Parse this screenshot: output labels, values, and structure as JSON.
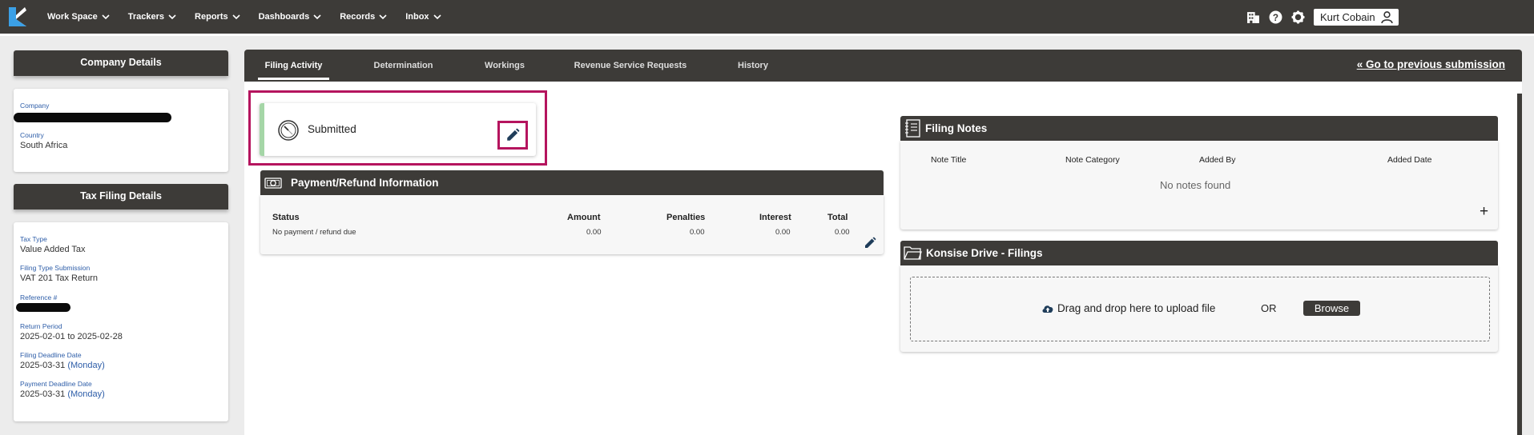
{
  "nav": {
    "items": [
      {
        "label": "Work Space"
      },
      {
        "label": "Trackers"
      },
      {
        "label": "Reports"
      },
      {
        "label": "Dashboards"
      },
      {
        "label": "Records"
      },
      {
        "label": "Inbox"
      }
    ],
    "right_icons": [
      "building-icon",
      "help-icon",
      "gear-icon"
    ],
    "user_name": "Kurt Cobain"
  },
  "sidebar": {
    "company_details": {
      "title": "Company Details",
      "company_label": "Company",
      "country_label": "Country",
      "country_value": "South Africa"
    },
    "tax_filing_details": {
      "title": "Tax Filing Details",
      "tax_type_label": "Tax Type",
      "tax_type_value": "Value Added Tax",
      "filing_type_label": "Filing Type Submission",
      "filing_type_value": "VAT 201 Tax Return",
      "reference_label": "Reference #",
      "return_period_label": "Return Period",
      "return_period_value": "2025-02-01 to 2025-02-28",
      "filing_deadline_label": "Filing Deadline Date",
      "filing_deadline_date": "2025-03-31",
      "filing_deadline_day": "(Monday)",
      "payment_deadline_label": "Payment Deadline Date",
      "payment_deadline_date": "2025-03-31",
      "payment_deadline_day": "(Monday)"
    }
  },
  "main": {
    "tabs": [
      {
        "label": "Filing Activity",
        "active": true
      },
      {
        "label": "Determination"
      },
      {
        "label": "Workings"
      },
      {
        "label": "Revenue Service Requests"
      },
      {
        "label": "History"
      }
    ],
    "go_previous": "« Go to previous submission",
    "status": {
      "label": "Submitted"
    },
    "payment": {
      "title": "Payment/Refund Information",
      "columns": [
        "Status",
        "Amount",
        "Penalties",
        "Interest",
        "Total"
      ],
      "row": {
        "status": "No payment / refund due",
        "amount": "0.00",
        "penalties": "0.00",
        "interest": "0.00",
        "total": "0.00"
      }
    },
    "filing_notes": {
      "title": "Filing Notes",
      "columns": [
        "Note Title",
        "Note Category",
        "Added By",
        "Added Date"
      ],
      "empty_text": "No notes found",
      "add_symbol": "+"
    },
    "drive": {
      "title": "Konsise Drive - Filings",
      "drop_text": "Drag and drop here to upload file",
      "or_text": "OR",
      "browse_label": "Browse"
    }
  },
  "colors": {
    "header_bg": "#3d3b38",
    "label_blue": "#2d5da8",
    "highlight": "#b5145e",
    "status_green": "#a5d6a7"
  }
}
